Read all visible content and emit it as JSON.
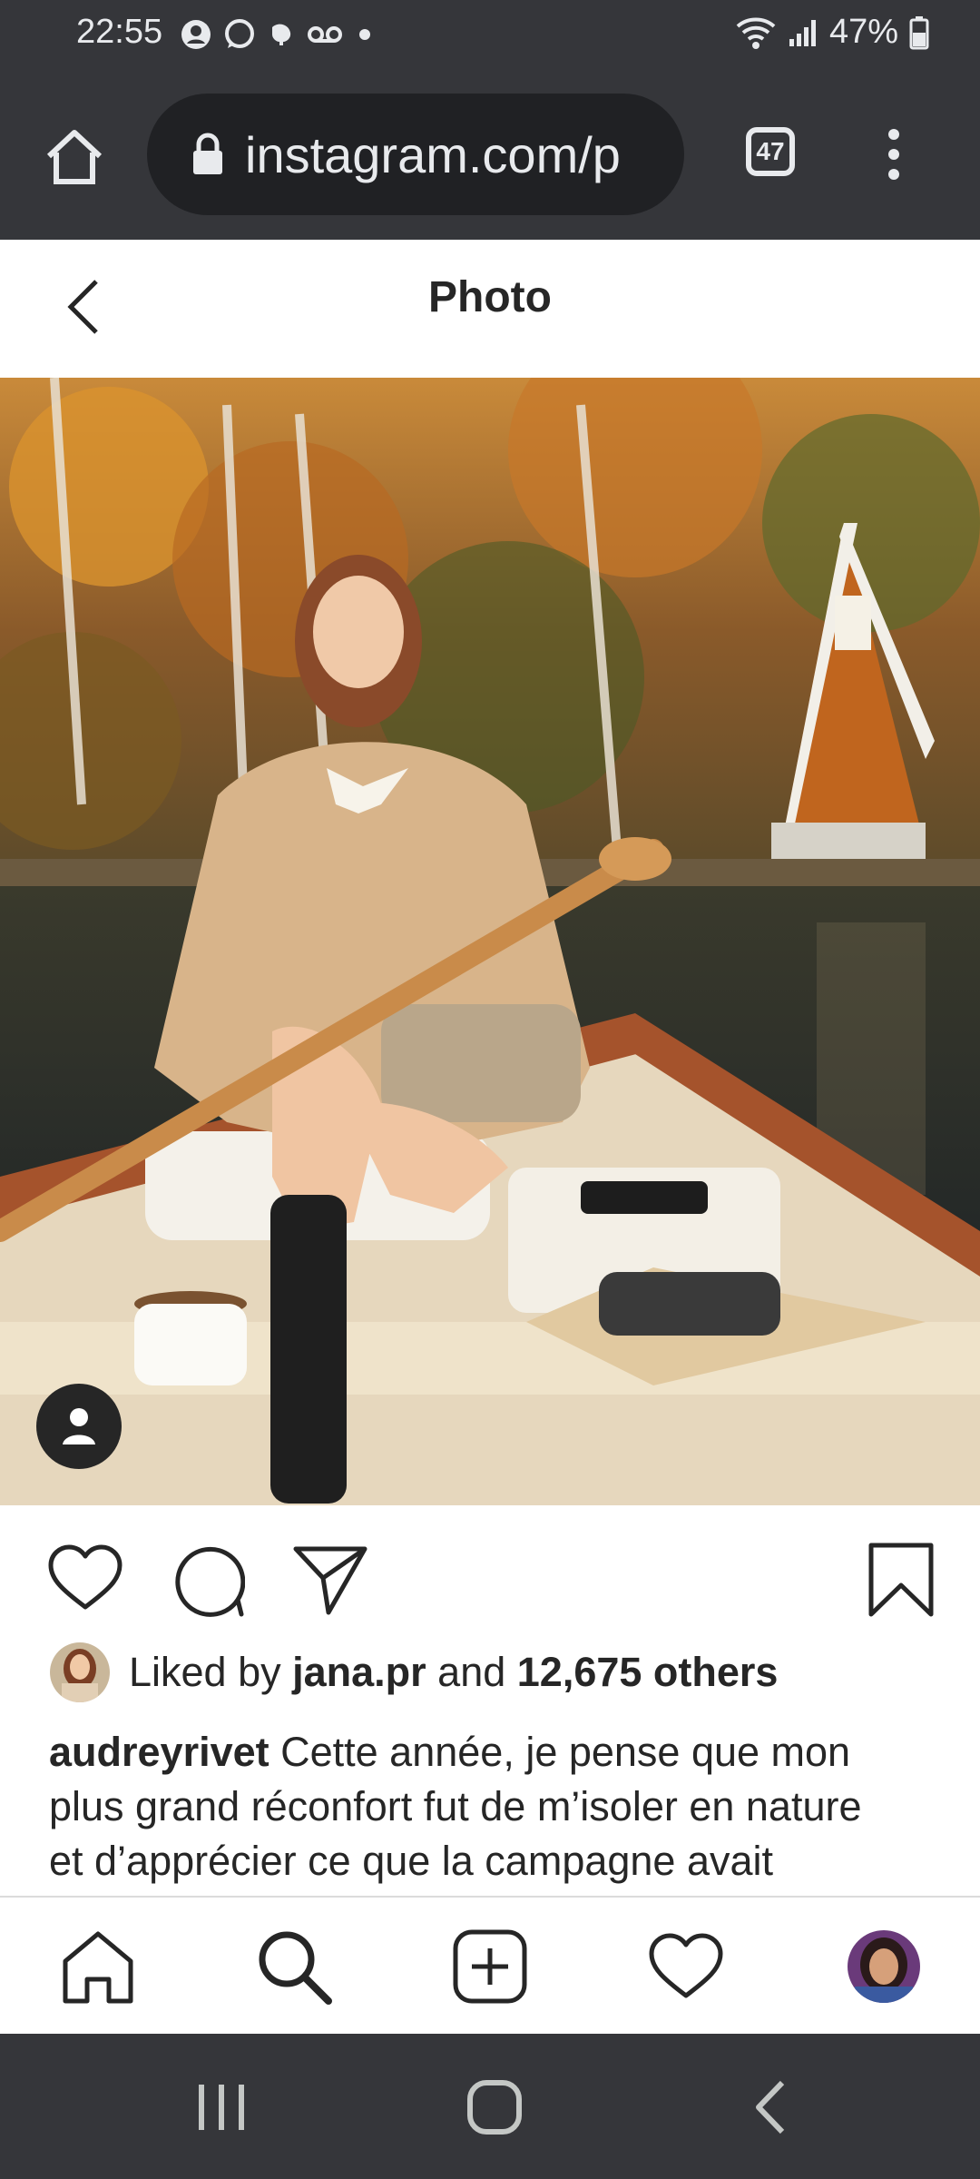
{
  "status_bar": {
    "time": "22:55",
    "battery": "47%",
    "icons": [
      "user-icon",
      "whatsapp-icon",
      "elephant-icon",
      "voicemail-icon",
      "dot-icon",
      "wifi-icon",
      "signal-icon",
      "battery-icon"
    ]
  },
  "browser": {
    "url": "instagram.com/p",
    "tab_count": "47",
    "icons": [
      "home-icon",
      "lock-icon",
      "tabs-icon",
      "more-icon"
    ]
  },
  "header": {
    "title": "Photo",
    "back_icon": "chevron-left-icon"
  },
  "post": {
    "liked_prefix": "Liked by ",
    "liked_user": "jana.pr",
    "liked_mid": " and ",
    "liked_count": "12,675 others",
    "author": "audreyrivet",
    "caption_lines": [
      " Cette année, je pense que mon",
      "plus grand réconfort fut de m’isoler en nature",
      "et d’apprécier ce que la campagne avait"
    ],
    "action_icons": [
      "heart-icon",
      "comment-icon",
      "share-icon",
      "bookmark-icon"
    ]
  },
  "bottom_nav": {
    "items": [
      "home-icon",
      "search-icon",
      "new-post-icon",
      "activity-icon",
      "profile-avatar"
    ]
  },
  "system_nav": {
    "items": [
      "recents-icon",
      "home-circle-icon",
      "back-icon"
    ]
  },
  "colors": {
    "chrome_bg": "#35363a",
    "url_bg": "#202124",
    "text": "#262626"
  }
}
